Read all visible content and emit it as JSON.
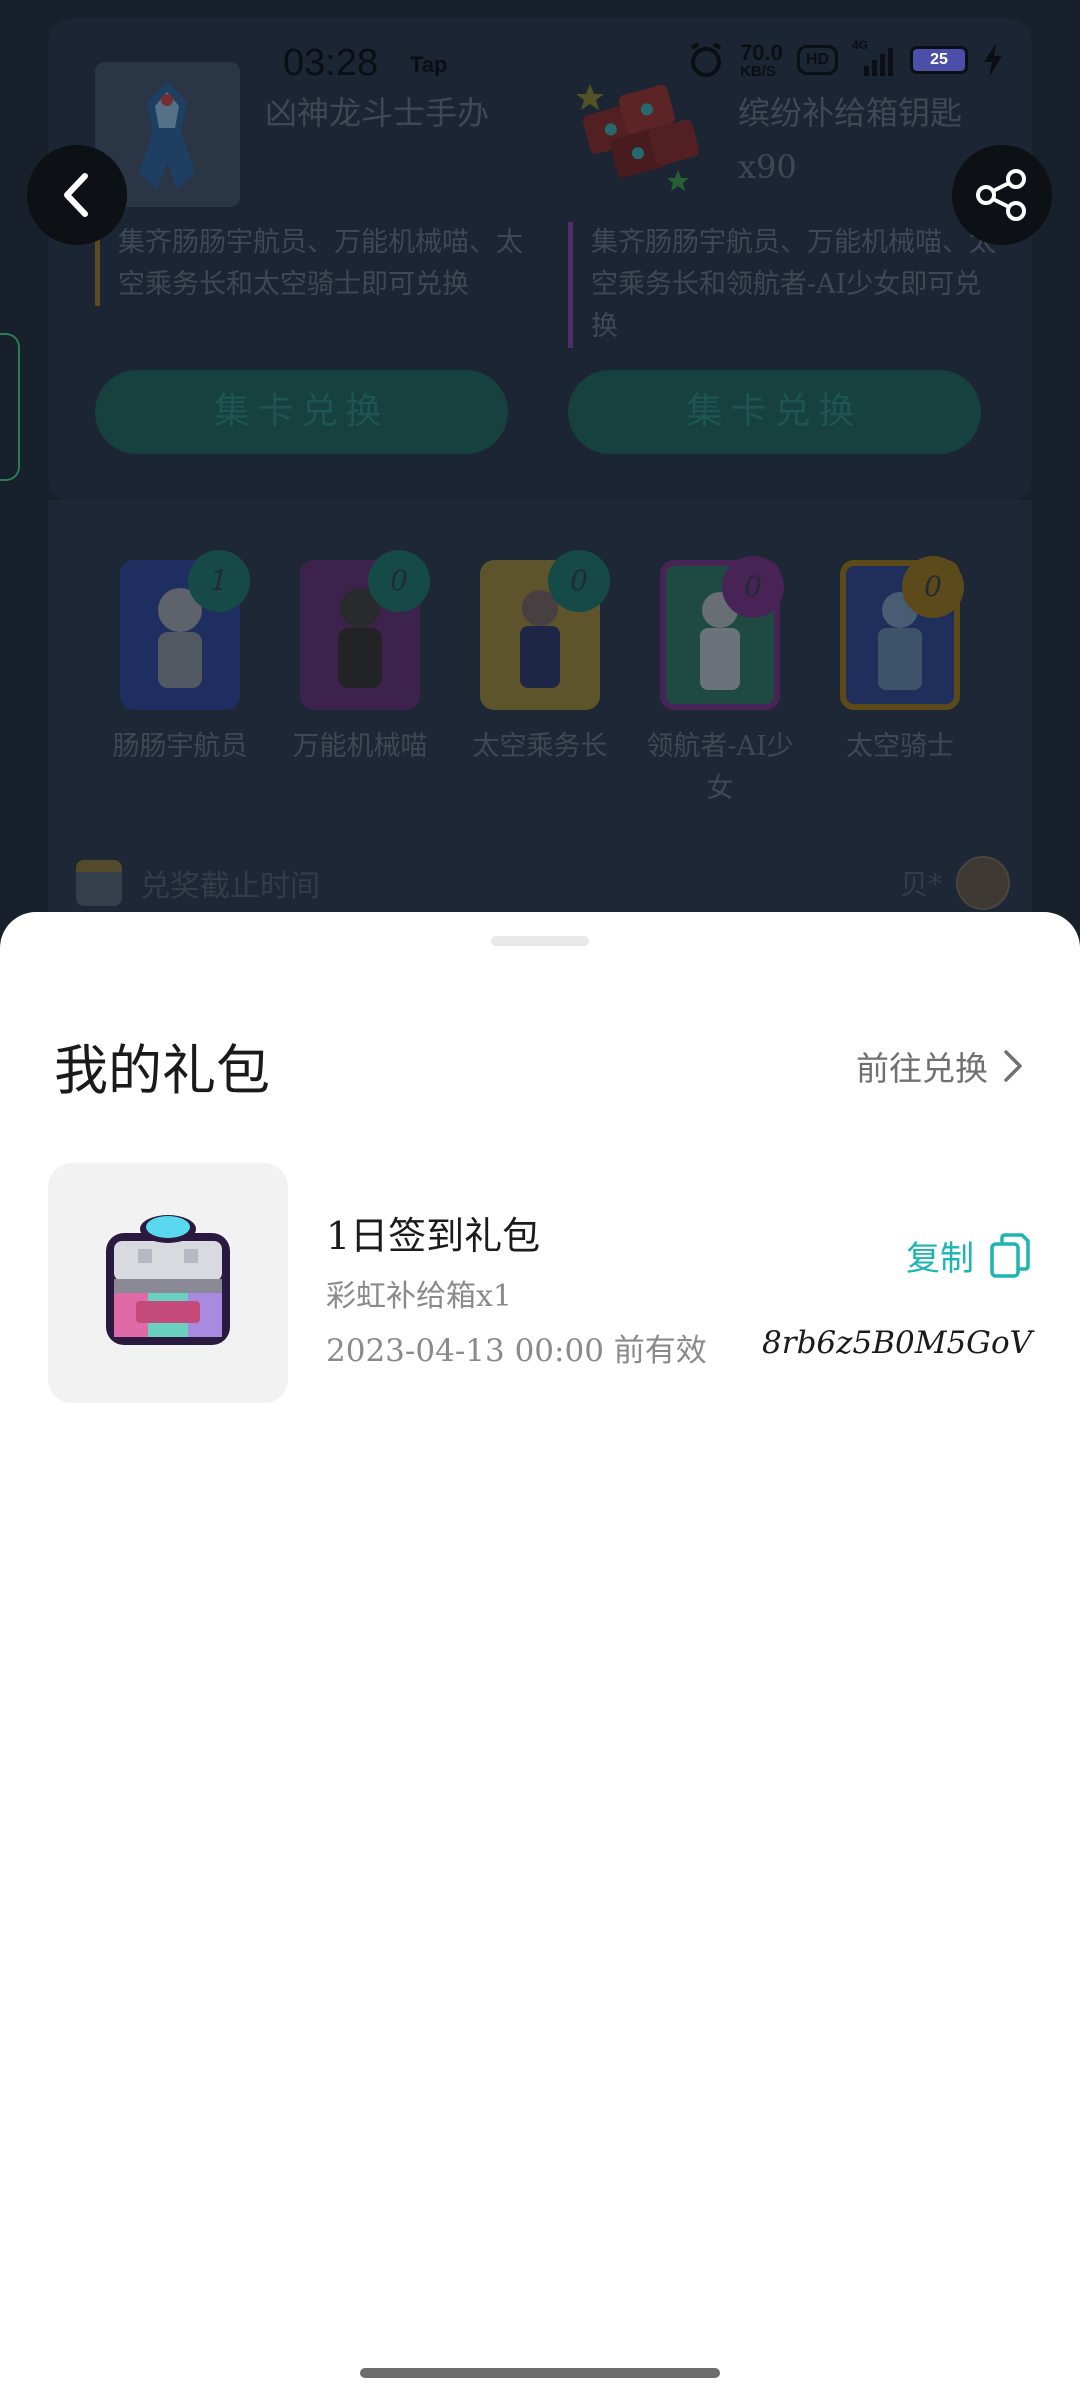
{
  "status_bar": {
    "time": "03:28",
    "app": "Tap",
    "net_speed_value": "70.0",
    "net_speed_unit": "KB/S",
    "hd_label": "HD",
    "network_label": "4G",
    "battery_level": "25"
  },
  "background": {
    "rewards": [
      {
        "name": "凶神龙斗士手办",
        "desc": "集齐肠肠宇航员、万能机械喵、太空乘务长和太空骑士即可兑换",
        "button": "集卡兑换"
      },
      {
        "name": "缤纷补给箱钥匙x90",
        "desc": "集齐肠肠宇航员、万能机械喵、太空乘务长和领航者-AI少女即可兑换",
        "button": "集卡兑换"
      }
    ],
    "characters": [
      {
        "name": "肠肠宇航员",
        "count": "1",
        "badge_color": "#1c6a62",
        "bg_color": "#2b3f8a"
      },
      {
        "name": "万能机械喵",
        "count": "0",
        "badge_color": "#1c6a62",
        "bg_color": "#5a2d6e"
      },
      {
        "name": "太空乘务长",
        "count": "0",
        "badge_color": "#1c6a62",
        "bg_color": "#8a7a3a"
      },
      {
        "name": "领航者-AI少女",
        "count": "0",
        "badge_color": "#6a2f7a",
        "bg_color": "#2a6a5a"
      },
      {
        "name": "太空骑士",
        "count": "0",
        "badge_color": "#8a6b1e",
        "bg_color": "#2b4080"
      }
    ],
    "deadline_label": "兑奖截止时间",
    "user_name": "贝*"
  },
  "sheet": {
    "title": "我的礼包",
    "redeem_link": "前往兑换",
    "gift": {
      "name": "1日签到礼包",
      "content": "彩虹补给箱x1",
      "expiry": "2023-04-13 00:00 前有效",
      "copy_label": "复制",
      "code": "8rb6z5B0M5GoV"
    }
  },
  "colors": {
    "accent_teal": "#1cb5b0",
    "sheet_bg": "#ffffff",
    "page_bg": "#1f2a38"
  }
}
